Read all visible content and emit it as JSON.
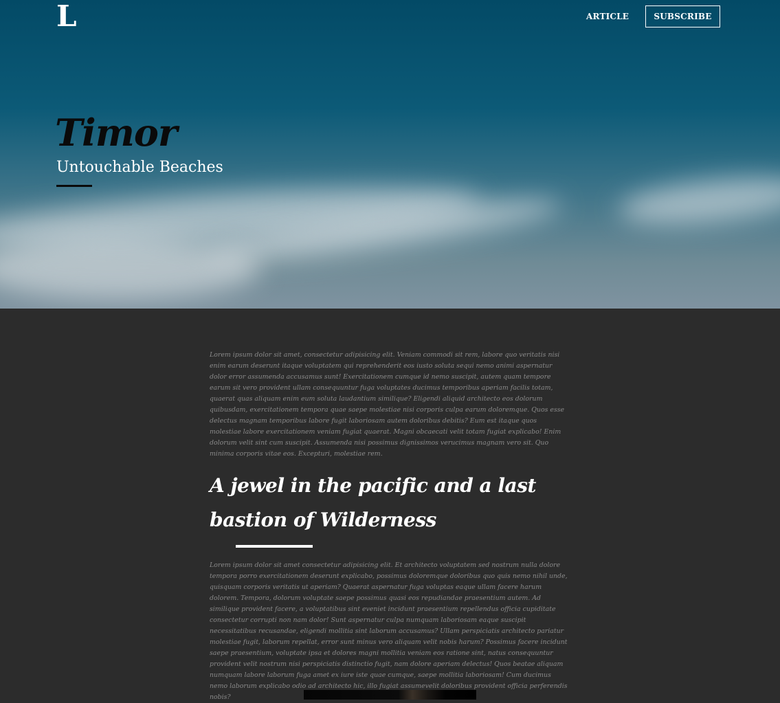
{
  "header": {
    "logo": "L",
    "nav": {
      "article": "ARTICLE",
      "subscribe": "SUBSCRIBE"
    }
  },
  "hero": {
    "title": "Timor",
    "subtitle": "Untouchable Beaches"
  },
  "article": {
    "intro": "Lorem ipsum dolor sit amet, consectetur adipisicing elit. Veniam commodi sit rem, labore quo veritatis nisi enim earum deserunt itaque voluptatem qui reprehenderit eos iusto soluta sequi nemo animi aspernatur dolor error assumenda accusamus sunt! Exercitationem cumque id nemo suscipit, autem quam tempore earum sit vero provident ullam consequuntur fuga voluptates ducimus temporibus aperiam facilis totam, quaerat quas aliquam enim eum soluta laudantium similique? Eligendi aliquid architecto eos dolorum quibusdam, exercitationem tempora quae saepe molestiae nisi corporis culpa earum doloremque. Quos esse delectus magnam temporibus labore fugit laboriosam autem doloribus debitis? Eum est itaque quos molestiae labore exercitationem veniam fugiat quaerat. Magni obcaecati velit totam fugiat explicabo! Enim dolorum velit sint cum suscipit. Assumenda nisi possimus dignissimos verucimus magnam vero sit. Quo minima corporis vitae eos. Excepturi, molestiae rem.",
    "heading": "A jewel in the pacific and a last bastion of Wilderness",
    "body": "Lorem ipsum dolor sit amet consectetur adipisicing elit. Et architecto voluptatem sed nostrum nulla dolore tempora porro exercitationem deserunt explicabo, possimus doloremque doloribus quo quis nemo nihil unde, quisquam corporis veritatis ut aperiam? Quaerat aspernatur fuga voluptas eaque ullam facere harum dolorem. Tempora, dolorum voluptate saepe possimus quasi eos repudiandae praesentium autem. Ad similique provident facere, a voluptatibus sint eveniet incidunt praesentium repellendus officia cupiditate consectetur corrupti non nam dolor! Sunt aspernatur culpa numquam laboriosam eaque suscipit necessitatibus recusandae, eligendi mollitia sint laborum accusamus? Ullam perspiciatis architecto pariatur molestiae fugit, laborum repellat, error sunt minus vero aliquam velit nobis harum? Possimus facere incidunt saepe praesentium, voluptate ipsa et dolores magni mollitia veniam eos ratione sint, natus consequuntur provident velit nostrum nisi perspiciatis distinctio fugit, nam dolore aperiam delectus! Quos beatae aliquam numquam labore laborum fuga amet ex iure iste quae cumque, saepe mollitia laboriosam! Cum ducimus nemo laborum explicabo odio ad architecto hic, illo fugiat assumevelit doloribus provident officia perferendis nobis?"
  },
  "colors": {
    "page_background": "#2c2c2c",
    "sky_top": "#034a66",
    "text_muted": "#8a8a8a",
    "text_light": "#ffffff",
    "title_dark": "#0a0a0a"
  }
}
